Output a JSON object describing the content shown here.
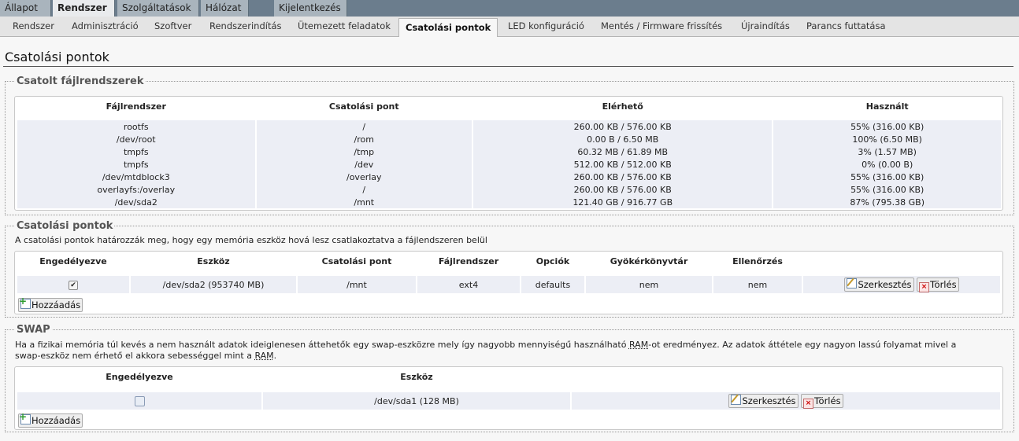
{
  "top_tabs": [
    "Állapot",
    "Rendszer",
    "Szolgáltatások",
    "Hálózat",
    "Kijelentkezés"
  ],
  "sub_tabs": [
    "Rendszer",
    "Adminisztráció",
    "Szoftver",
    "Rendszerindítás",
    "Ütemezett feladatok",
    "Csatolási pontok",
    "LED konfiguráció",
    "Mentés / Firmware frissítés",
    "Újraindítás",
    "Parancs futtatása"
  ],
  "page_title": "Csatolási pontok",
  "mounted": {
    "legend": "Csatolt fájlrendszerek",
    "headers": [
      "Fájlrendszer",
      "Csatolási pont",
      "Elérhető",
      "Használt"
    ],
    "rows": [
      [
        "rootfs",
        "/",
        "260.00 KB / 576.00 KB",
        "55% (316.00 KB)"
      ],
      [
        "/dev/root",
        "/rom",
        "0.00 B / 6.50 MB",
        "100% (6.50 MB)"
      ],
      [
        "tmpfs",
        "/tmp",
        "60.32 MB / 61.89 MB",
        "3% (1.57 MB)"
      ],
      [
        "tmpfs",
        "/dev",
        "512.00 KB / 512.00 KB",
        "0% (0.00 B)"
      ],
      [
        "/dev/mtdblock3",
        "/overlay",
        "260.00 KB / 576.00 KB",
        "55% (316.00 KB)"
      ],
      [
        "overlayfs:/overlay",
        "/",
        "260.00 KB / 576.00 KB",
        "55% (316.00 KB)"
      ],
      [
        "/dev/sda2",
        "/mnt",
        "121.40 GB / 916.77 GB",
        "87% (795.38 GB)"
      ]
    ]
  },
  "mountpoints": {
    "legend": "Csatolási pontok",
    "description": "A csatolási pontok határozzák meg, hogy egy memória eszköz hová lesz csatlakoztatva a fájlendszeren belül",
    "headers": [
      "Engedélyezve",
      "Eszköz",
      "Csatolási pont",
      "Fájlrendszer",
      "Opciók",
      "Gyökérkönyvtár",
      "Ellenőrzés"
    ],
    "row": {
      "enabled": true,
      "device": "/dev/sda2 (953740 MB)",
      "mountpoint": "/mnt",
      "fs": "ext4",
      "options": "defaults",
      "root": "nem",
      "check": "nem"
    },
    "edit_label": "Szerkesztés",
    "delete_label": "Törlés",
    "add_label": "Hozzáadás"
  },
  "swap": {
    "legend": "SWAP",
    "desc_1": "Ha a fizikai memória túl kevés a nem használt adatok ideiglenesen áttehetők egy swap-eszközre mely így nagyobb mennyiségű használható ",
    "ram": "RAM",
    "desc_2": "-ot eredményez. Az adatok áttétele egy nagyon lassú folyamat mivel a",
    "desc_3": "swap-eszköz nem érhető el akkora sebességgel mint a ",
    "desc_4": ".",
    "headers": [
      "Engedélyezve",
      "Eszköz"
    ],
    "row": {
      "enabled": false,
      "device": "/dev/sda1 (128 MB)"
    },
    "edit_label": "Szerkesztés",
    "delete_label": "Törlés",
    "add_label": "Hozzáadás"
  }
}
